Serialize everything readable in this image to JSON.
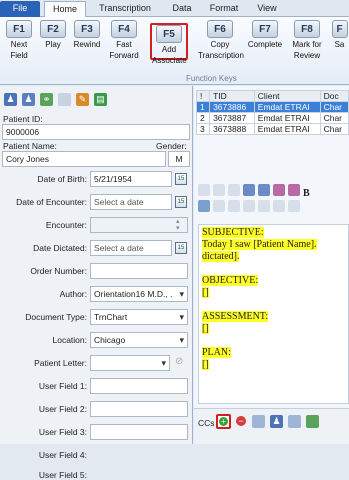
{
  "ribbon": {
    "tabs": [
      "File",
      "Home",
      "Transcription",
      "Data",
      "Format",
      "View"
    ],
    "buttons": [
      {
        "key": "F1",
        "label1": "Next",
        "label2": "Field"
      },
      {
        "key": "F2",
        "label1": "Play",
        "label2": ""
      },
      {
        "key": "F3",
        "label1": "Rewind",
        "label2": ""
      },
      {
        "key": "F4",
        "label1": "Fast",
        "label2": "Forward"
      },
      {
        "key": "F5",
        "label1": "Add",
        "label2": "Associate"
      },
      {
        "key": "F6",
        "label1": "Copy",
        "label2": "Transcription"
      },
      {
        "key": "F7",
        "label1": "Complete",
        "label2": ""
      },
      {
        "key": "F8",
        "label1": "Mark for",
        "label2": "Review"
      },
      {
        "key": "F",
        "label1": "Sa",
        "label2": ""
      }
    ],
    "group_label": "Function Keys"
  },
  "patient": {
    "id_label": "Patient ID:",
    "id": "9000006",
    "name_label": "Patient Name:",
    "gender_label": "Gender:",
    "name": "Cory Jones",
    "gender": "M"
  },
  "form": {
    "dob_label": "Date of Birth:",
    "dob": "5/21/1954",
    "doe_label": "Date of Encounter:",
    "doe": "Select a date",
    "encounter_label": "Encounter:",
    "encounter": "",
    "dictated_label": "Date Dictated:",
    "dictated": "Select a date",
    "order_label": "Order Number:",
    "order": "",
    "author_label": "Author:",
    "author": "Orientation16 M.D., .",
    "doctype_label": "Document Type:",
    "doctype": "TrnChart",
    "location_label": "Location:",
    "location": "Chicago",
    "letter_label": "Patient Letter:",
    "letter": "",
    "uf1": "User Field 1:",
    "uf2": "User Field 2:",
    "uf3": "User Field 3:",
    "uf4": "User Field 4:",
    "uf5": "User Field 5:",
    "cal": "15"
  },
  "grid": {
    "headers": [
      "!",
      "TID",
      "Client",
      "Doc"
    ],
    "rows": [
      [
        "1",
        "3673886",
        "Emdat ETRAI",
        "Char"
      ],
      [
        "2",
        "3673887",
        "Emdat ETRAI",
        "Char"
      ],
      [
        "3",
        "3673888",
        "Emdat ETRAI",
        "Char"
      ]
    ]
  },
  "note": {
    "s_head": "SUBJECTIVE:",
    "s_text1": "Today I saw [Patient Name].",
    "s_text2": "dictated].",
    "o_head": "OBJECTIVE:",
    "a_head": "ASSESSMENT:",
    "p_head": "PLAN:",
    "field": "[]"
  },
  "ccs_label": "CCs"
}
